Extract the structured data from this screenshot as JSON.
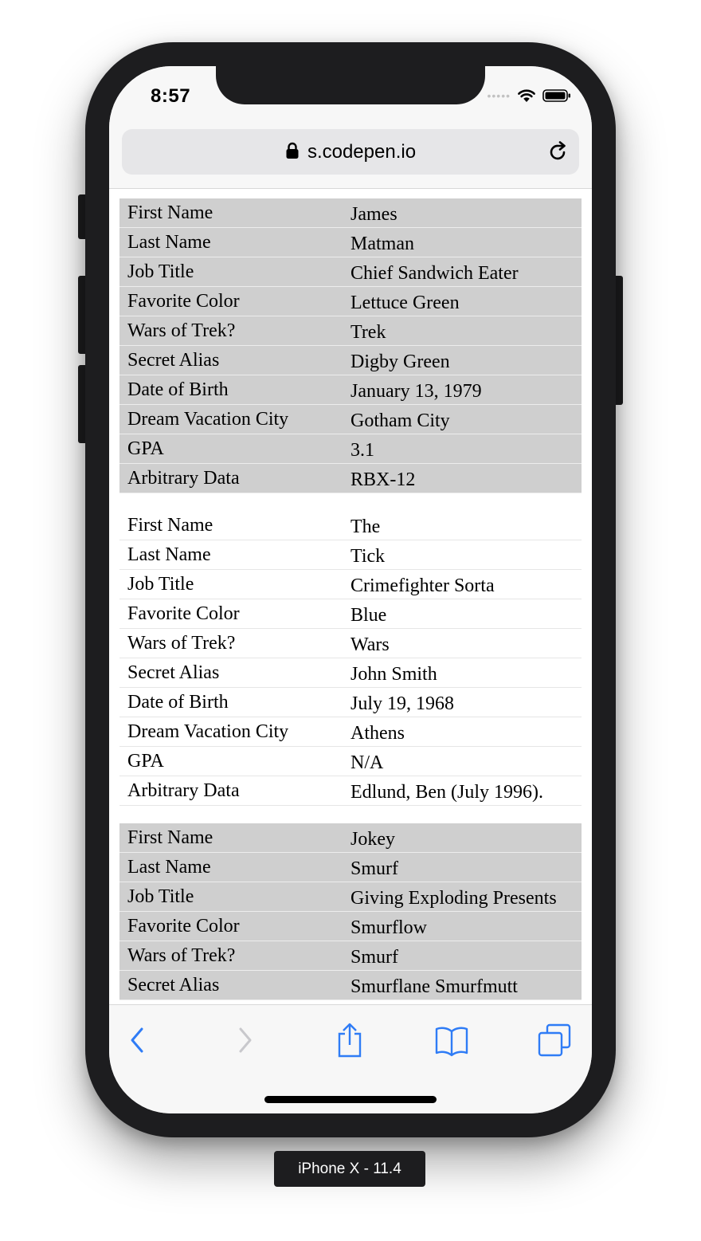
{
  "status_bar": {
    "time": "8:57"
  },
  "browser": {
    "url": "s.codepen.io"
  },
  "records": [
    {
      "shaded": true,
      "rows": [
        {
          "label": "First Name",
          "value": "James"
        },
        {
          "label": "Last Name",
          "value": "Matman"
        },
        {
          "label": "Job Title",
          "value": "Chief Sandwich Eater"
        },
        {
          "label": "Favorite Color",
          "value": "Lettuce Green"
        },
        {
          "label": "Wars of Trek?",
          "value": "Trek"
        },
        {
          "label": "Secret Alias",
          "value": "Digby Green"
        },
        {
          "label": "Date of Birth",
          "value": "January 13, 1979"
        },
        {
          "label": "Dream Vacation City",
          "value": "Gotham City"
        },
        {
          "label": "GPA",
          "value": "3.1"
        },
        {
          "label": "Arbitrary Data",
          "value": "RBX-12"
        }
      ]
    },
    {
      "shaded": false,
      "rows": [
        {
          "label": "First Name",
          "value": "The"
        },
        {
          "label": "Last Name",
          "value": "Tick"
        },
        {
          "label": "Job Title",
          "value": "Crimefighter Sorta"
        },
        {
          "label": "Favorite Color",
          "value": "Blue"
        },
        {
          "label": "Wars of Trek?",
          "value": "Wars"
        },
        {
          "label": "Secret Alias",
          "value": "John Smith"
        },
        {
          "label": "Date of Birth",
          "value": "July 19, 1968"
        },
        {
          "label": "Dream Vacation City",
          "value": "Athens"
        },
        {
          "label": "GPA",
          "value": "N/A"
        },
        {
          "label": "Arbitrary Data",
          "value": "Edlund, Ben (July 1996)."
        }
      ]
    },
    {
      "shaded": true,
      "rows": [
        {
          "label": "First Name",
          "value": "Jokey"
        },
        {
          "label": "Last Name",
          "value": "Smurf"
        },
        {
          "label": "Job Title",
          "value": "Giving Exploding Presents"
        },
        {
          "label": "Favorite Color",
          "value": "Smurflow"
        },
        {
          "label": "Wars of Trek?",
          "value": "Smurf"
        },
        {
          "label": "Secret Alias",
          "value": "Smurflane Smurfmutt"
        }
      ]
    }
  ],
  "toolbar": {
    "icons": [
      "back-icon",
      "forward-icon",
      "share-icon",
      "bookmarks-icon",
      "tabs-icon"
    ],
    "accent_color": "#2f7cf6",
    "disabled_color": "#c8c8cc"
  },
  "device_label": "iPhone X - 11.4"
}
